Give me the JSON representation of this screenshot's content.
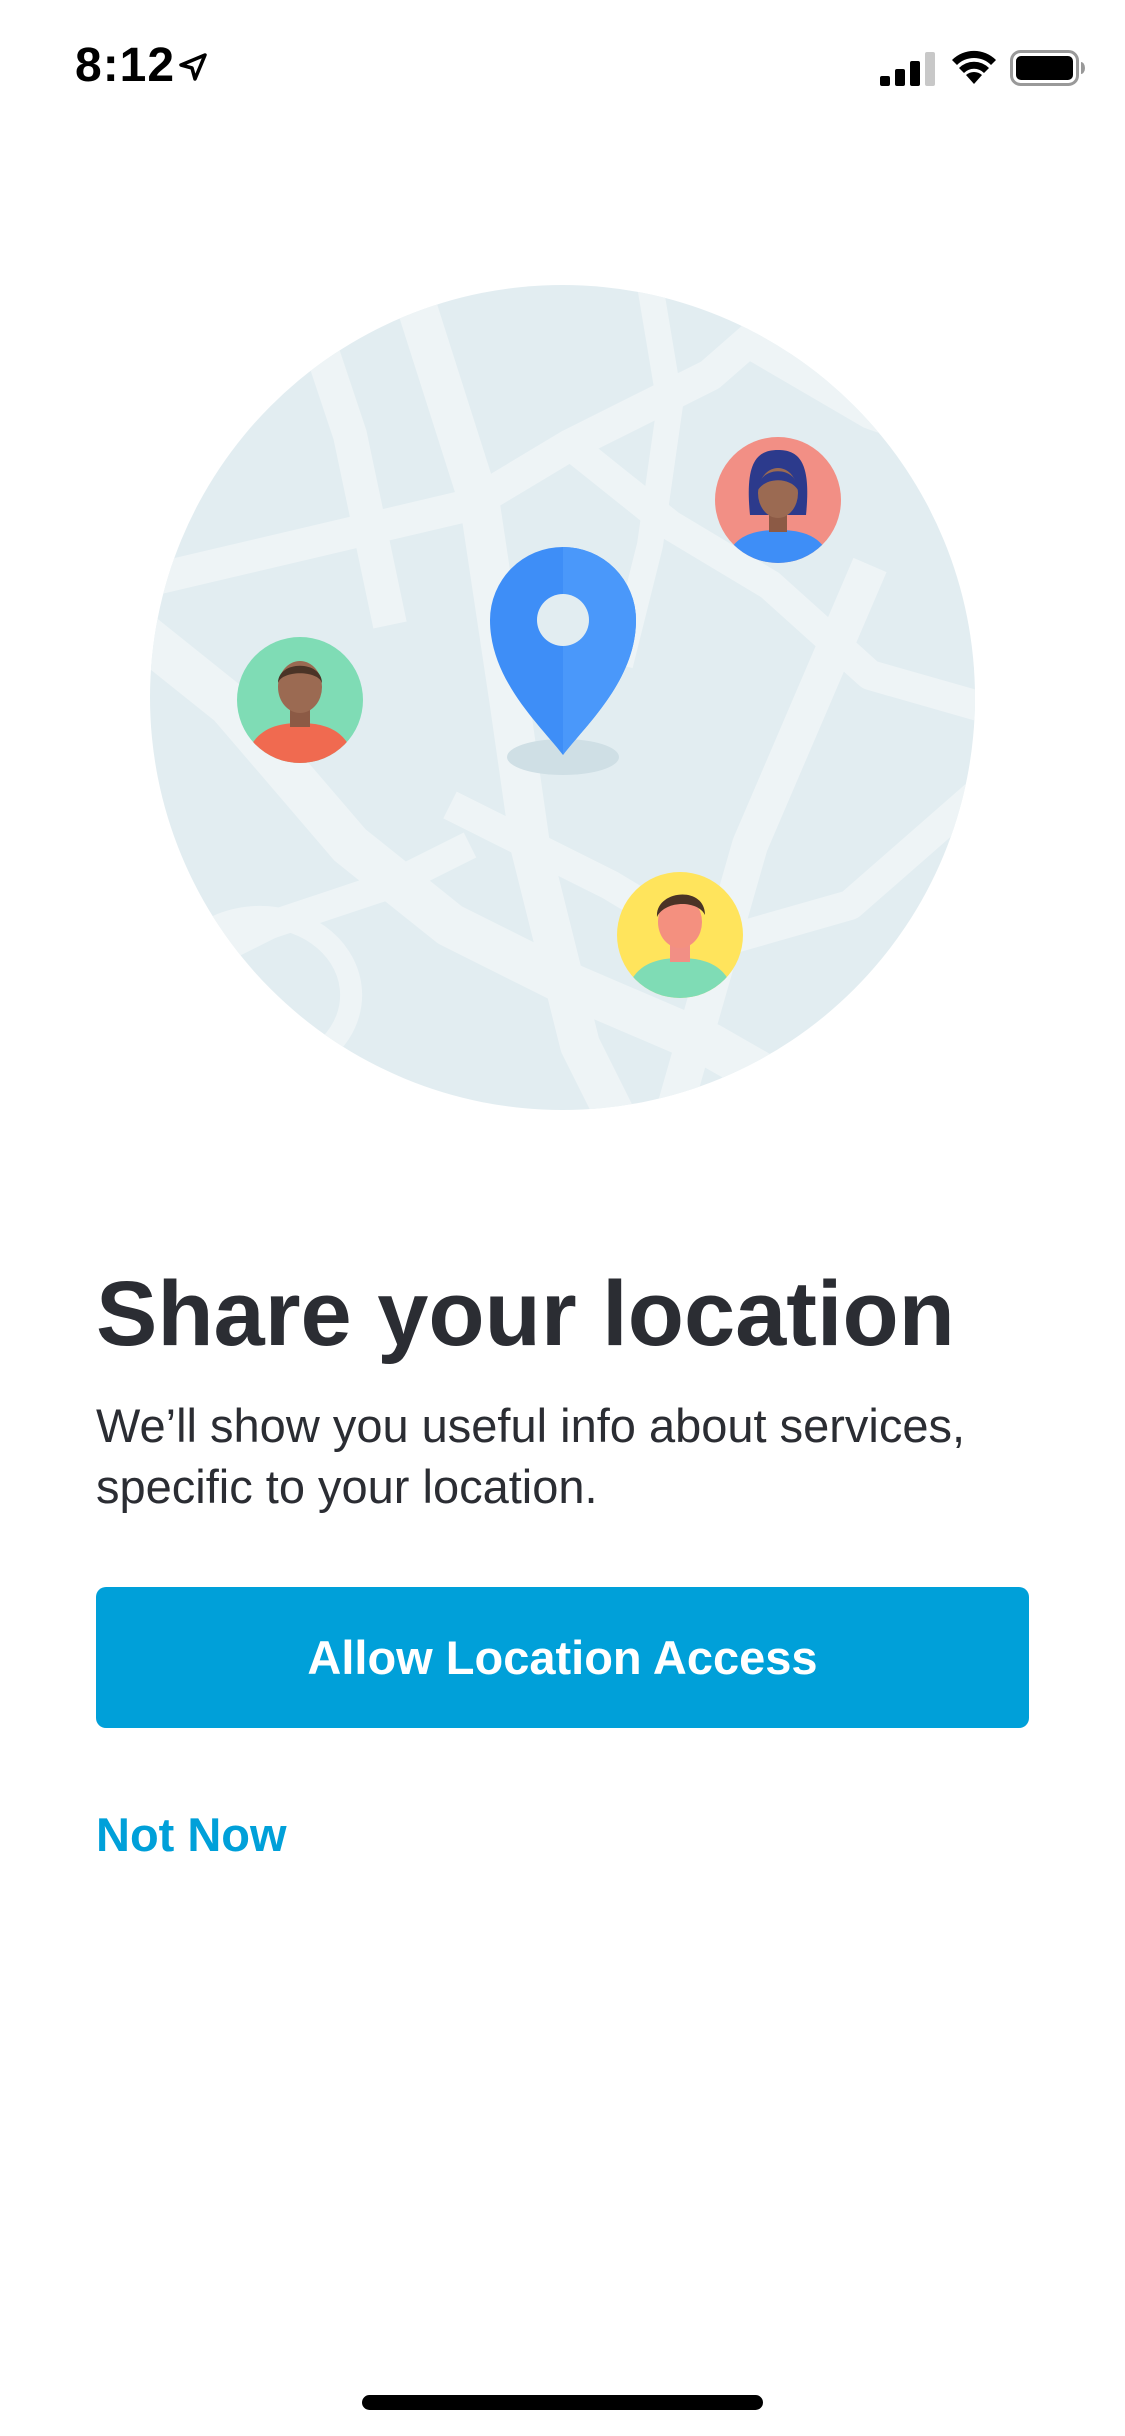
{
  "status_bar": {
    "time": "8:12",
    "icons": [
      "location-arrow-icon",
      "cellular-signal-icon",
      "wifi-icon",
      "battery-icon"
    ]
  },
  "illustration": {
    "description_icon": "map-with-pin-and-people",
    "colors": {
      "map_background": "#e2edf1",
      "roads": "#eef4f6",
      "pin": "#3e8ef7",
      "avatar_left_bg": "#7fdcb5",
      "avatar_top_right_bg": "#f28f85",
      "avatar_bottom_bg": "#ffe45c"
    }
  },
  "content": {
    "title": "Share your location",
    "subtitle": "We’ll show you useful info about services, specific to your location."
  },
  "actions": {
    "allow_label": "Allow Location Access",
    "not_now_label": "Not Now"
  },
  "theme": {
    "accent": "#00a0d9",
    "text": "#2b2d33"
  }
}
